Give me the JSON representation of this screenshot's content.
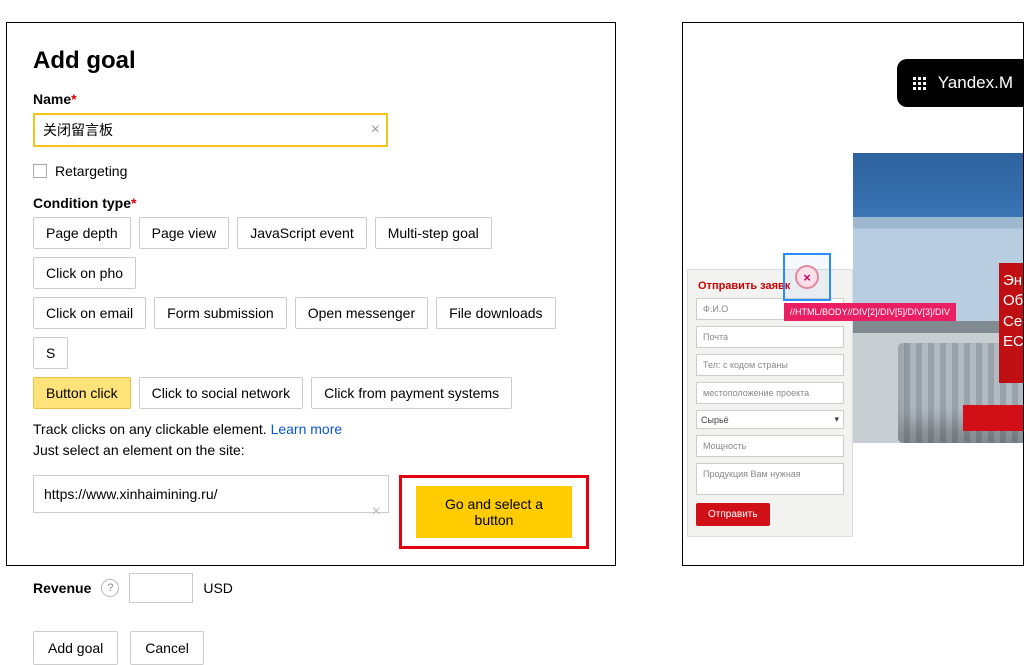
{
  "left": {
    "title": "Add goal",
    "name_label": "Name",
    "name_value": "关闭留言板",
    "retargeting_label": "Retargeting",
    "condition_label": "Condition type",
    "conditions_row1": [
      "Page depth",
      "Page view",
      "JavaScript event",
      "Multi-step goal",
      "Click on pho"
    ],
    "conditions_row2": [
      "Click on email",
      "Form submission",
      "Open messenger",
      "File downloads",
      "S"
    ],
    "conditions_row3": [
      "Button click",
      "Click to social network",
      "Click from payment systems"
    ],
    "selected_condition": "Button click",
    "help_line1": "Track clicks on any clickable element. ",
    "help_link": "Learn more",
    "help_line2": "Just select an element on the site:",
    "url_value": "https://www.xinhaimining.ru/",
    "go_button": "Go and select a button",
    "revenue_label": "Revenue",
    "revenue_currency": "USD",
    "add_goal": "Add goal",
    "cancel": "Cancel"
  },
  "right": {
    "yandex_label": "Yandex.M",
    "form_title": "Отправить заявк",
    "fields": {
      "fio": "Ф.И.О",
      "email": "Почта",
      "tel": "Тел: с кодом страны",
      "loc": "местоположение проекта",
      "select_value": "Сырьё",
      "power": "Мощность",
      "product": "Продукция Вам нужная"
    },
    "submit": "Отправить",
    "xpath": "//HTML/BODY//DIV[2]/DIV[5]/DIV[3]/DIV",
    "red_side": "Эн\nОб\nСе\nЕС"
  }
}
